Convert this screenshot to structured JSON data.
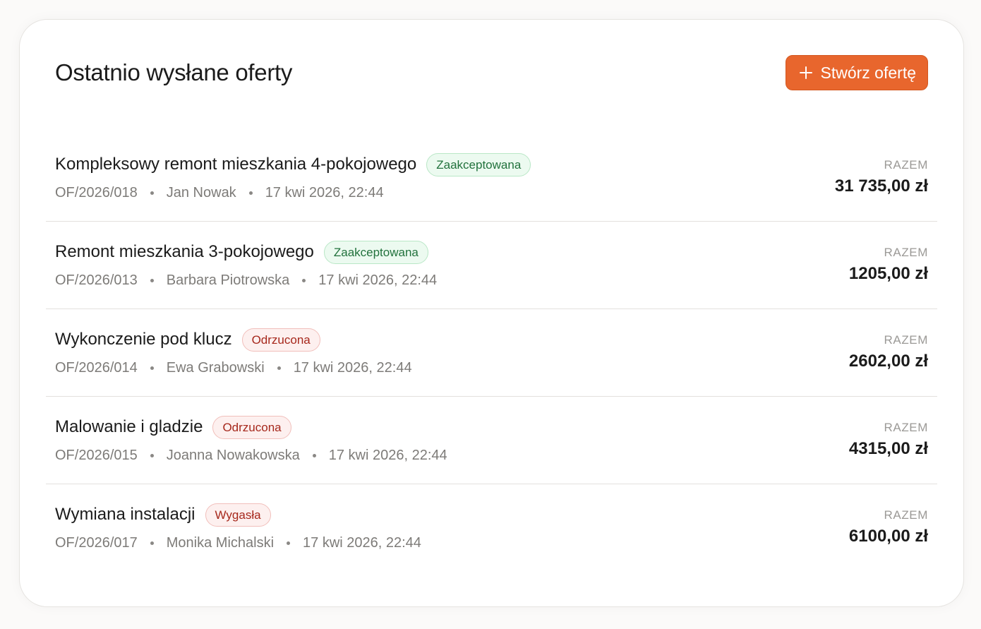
{
  "header": {
    "title": "Ostatnio wysłane oferty",
    "create_button_label": "Stwórz ofertę",
    "create_button_icon": "plus-icon"
  },
  "colors": {
    "accent": "#e8662d",
    "accepted": "#22723d",
    "rejected": "#a6281c"
  },
  "offers": [
    {
      "title": "Kompleksowy remont mieszkania 4-pokojowego",
      "status": "Zaakceptowana",
      "status_type": "accepted",
      "number": "OF/2026/018",
      "client": "Jan Nowak",
      "date": "17 kwi 2026, 22:44",
      "total_label": "RAZEM",
      "total": "31 735,00 zł"
    },
    {
      "title": "Remont mieszkania 3-pokojowego",
      "status": "Zaakceptowana",
      "status_type": "accepted",
      "number": "OF/2026/013",
      "client": "Barbara Piotrowska",
      "date": "17 kwi 2026, 22:44",
      "total_label": "RAZEM",
      "total": "1205,00 zł"
    },
    {
      "title": "Wykonczenie pod klucz",
      "status": "Odrzucona",
      "status_type": "rejected",
      "number": "OF/2026/014",
      "client": "Ewa Grabowski",
      "date": "17 kwi 2026, 22:44",
      "total_label": "RAZEM",
      "total": "2602,00 zł"
    },
    {
      "title": "Malowanie i gladzie",
      "status": "Odrzucona",
      "status_type": "rejected",
      "number": "OF/2026/015",
      "client": "Joanna Nowakowska",
      "date": "17 kwi 2026, 22:44",
      "total_label": "RAZEM",
      "total": "4315,00 zł"
    },
    {
      "title": "Wymiana instalacji",
      "status": "Wygasła",
      "status_type": "expired",
      "number": "OF/2026/017",
      "client": "Monika Michalski",
      "date": "17 kwi 2026, 22:44",
      "total_label": "RAZEM",
      "total": "6100,00 zł"
    }
  ]
}
